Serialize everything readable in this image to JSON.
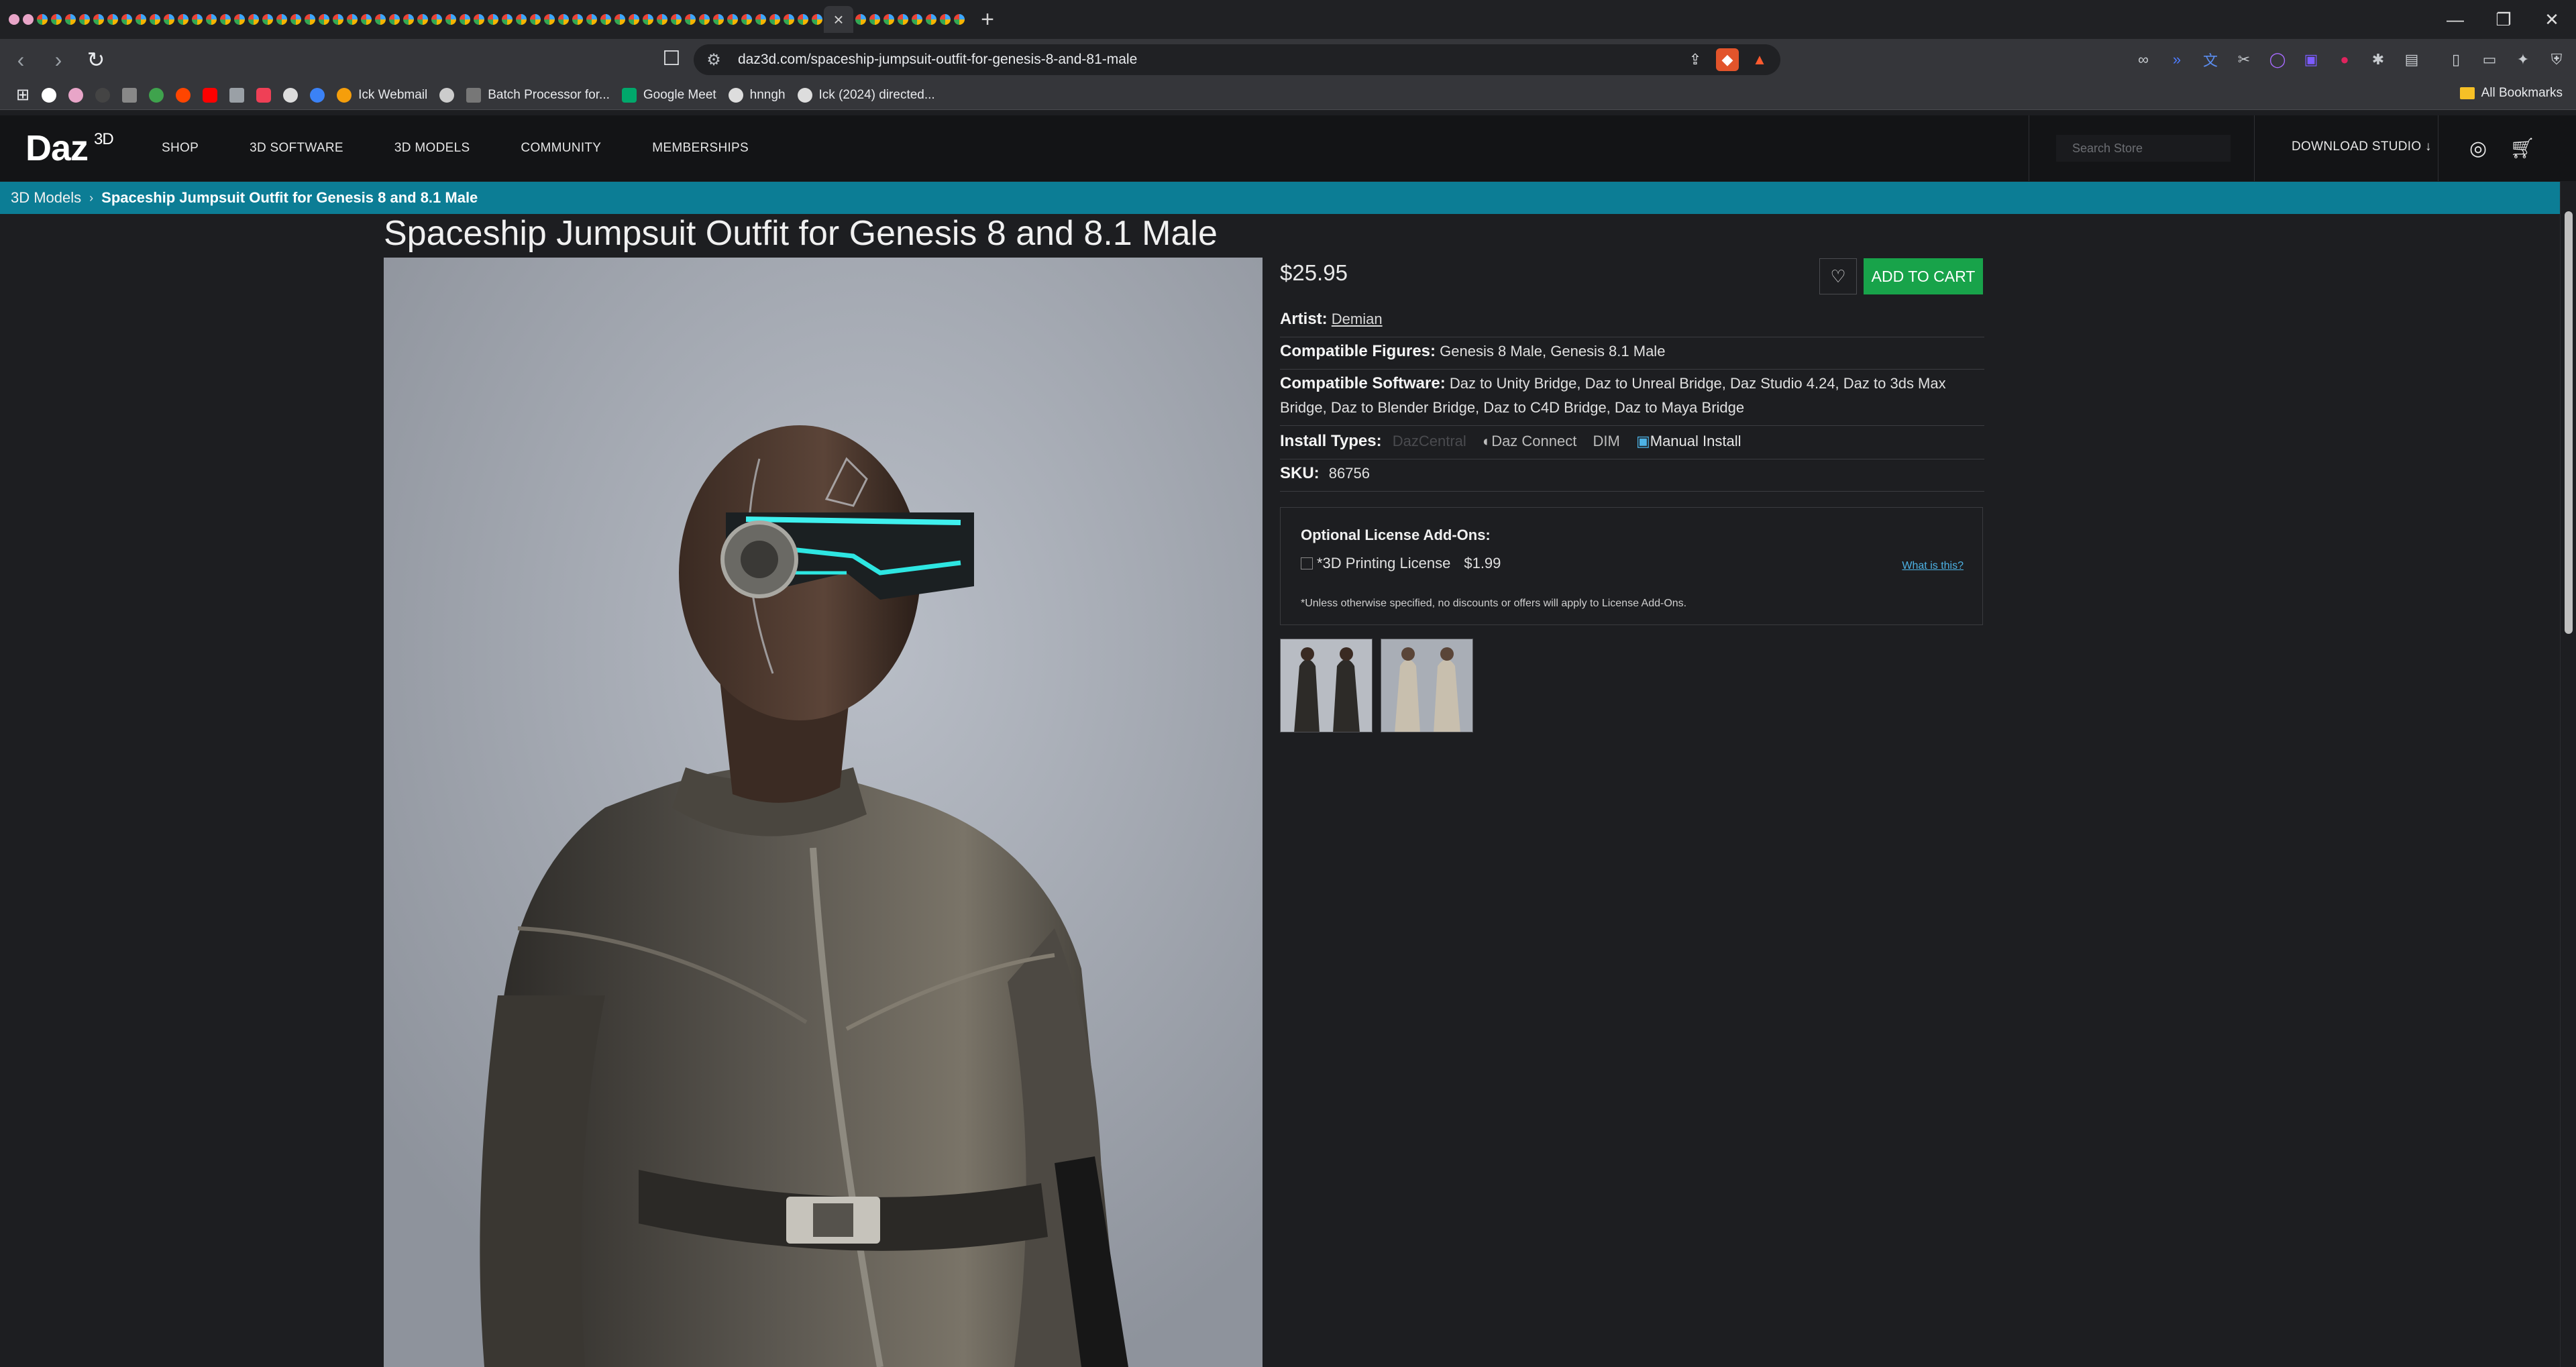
{
  "browser": {
    "url": "daz3d.com/spaceship-jumpsuit-outfit-for-genesis-8-and-81-male",
    "bookmarks": [
      "Ick Webmail",
      "Batch Processor for...",
      "Google Meet",
      "hnngh",
      "Ick (2024) directed..."
    ],
    "all_bookmarks": "All Bookmarks",
    "window_controls": [
      "—",
      "❐",
      "✕"
    ]
  },
  "site": {
    "logo": "Daz",
    "logo_sup": "3D",
    "nav": [
      "SHOP",
      "3D SOFTWARE",
      "3D MODELS",
      "COMMUNITY",
      "MEMBERSHIPS"
    ],
    "search_placeholder": "Search Store",
    "download_studio": "DOWNLOAD STUDIO"
  },
  "breadcrumb": {
    "parent": "3D Models",
    "separator": "›",
    "current": "Spaceship Jumpsuit Outfit for Genesis 8 and 8.1 Male"
  },
  "product": {
    "title": "Spaceship Jumpsuit Outfit for Genesis 8 and 8.1 Male",
    "price": "$25.95",
    "add_to_cart": "ADD TO CART",
    "artist_label": "Artist:",
    "artist": "Demian",
    "figures_label": "Compatible Figures:",
    "figures": "Genesis 8 Male, Genesis 8.1 Male",
    "software_label": "Compatible Software:",
    "software": "Daz to Unity Bridge, Daz to Unreal Bridge, Daz Studio 4.24, Daz to 3ds Max Bridge, Daz to Blender Bridge, Daz to C4D Bridge, Daz to Maya Bridge",
    "install_label": "Install Types:",
    "install_types": [
      "DazCentral",
      "Daz Connect",
      "DIM",
      "Manual Install"
    ],
    "sku_label": "SKU:",
    "sku": "86756"
  },
  "license": {
    "heading": "Optional License Add-Ons:",
    "item": "*3D Printing License",
    "price": "$1.99",
    "what_is_this": "What is this?",
    "note": "*Unless otherwise specified, no discounts or offers will apply to License Add-Ons."
  },
  "colors": {
    "breadcrumb_bg": "#0c7d95",
    "cart_button": "#18a34a",
    "header_bg": "#131416",
    "page_bg": "#1d1e21"
  }
}
